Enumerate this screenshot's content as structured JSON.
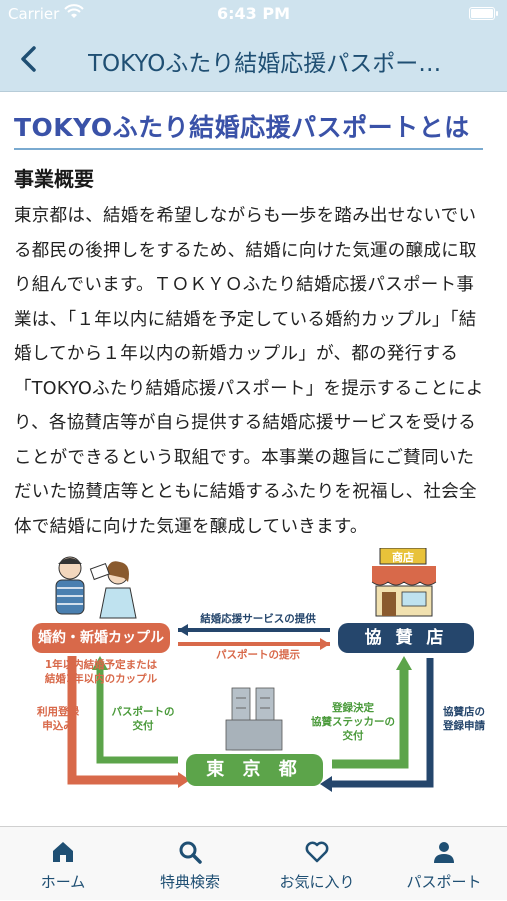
{
  "status": {
    "carrier": "Carrier",
    "time": "6:43 PM"
  },
  "nav": {
    "title": "TOKYOふたり結婚応援パスポー…"
  },
  "page": {
    "heading": "TOKYOふたり結婚応援パスポートとは",
    "section_title": "事業概要",
    "body": "東京都は、結婚を希望しながらも一歩を踏み出せないでいる都民の後押しをするため、結婚に向けた気運の醸成に取り組んでいます。ＴＯＫＹＯふたり結婚応援パスポート事業は、「１年以内に結婚を予定している婚約カップル」「結婚してから１年以内の新婚カップル」が、都の発行する「TOKYOふたり結婚応援パスポート」を提示することにより、各協賛店等が自ら提供する結婚応援サービスを受けることができるという取組です。本事業の趣旨にご賛同いただいた協賛店等とともに結婚するふたりを祝福し、社会全体で結婚に向けた気運を醸成していきます。"
  },
  "diagram": {
    "couple_label": "婚約・新婚カップル",
    "couple_note_1": "1年以内結婚予定または",
    "couple_note_2": "結婚1年以内のカップル",
    "shop_label": "協 賛 店",
    "shop_sign": "商店",
    "tokyo_label": "東 京 都",
    "service_arrow": "結婚応援サービスの提供",
    "passport_arrow": "パスポートの提示",
    "apply_1": "利用登録",
    "apply_2": "申込み",
    "issue_1": "パスポートの",
    "issue_2": "交付",
    "decision_1": "登録決定",
    "decision_2": "協賛ステッカーの",
    "decision_3": "交付",
    "register_1": "協賛店の",
    "register_2": "登録申請"
  },
  "tabs": [
    {
      "label": "ホーム",
      "icon": "home-icon"
    },
    {
      "label": "特典検索",
      "icon": "search-icon"
    },
    {
      "label": "お気に入り",
      "icon": "heart-icon"
    },
    {
      "label": "パスポート",
      "icon": "person-icon"
    }
  ],
  "colors": {
    "nav_bg": "#cfe3ee",
    "accent": "#1f4f73",
    "heading": "#3a52a8",
    "couple": "#d8694a",
    "shop": "#25466c",
    "tokyo": "#5ca44a"
  }
}
